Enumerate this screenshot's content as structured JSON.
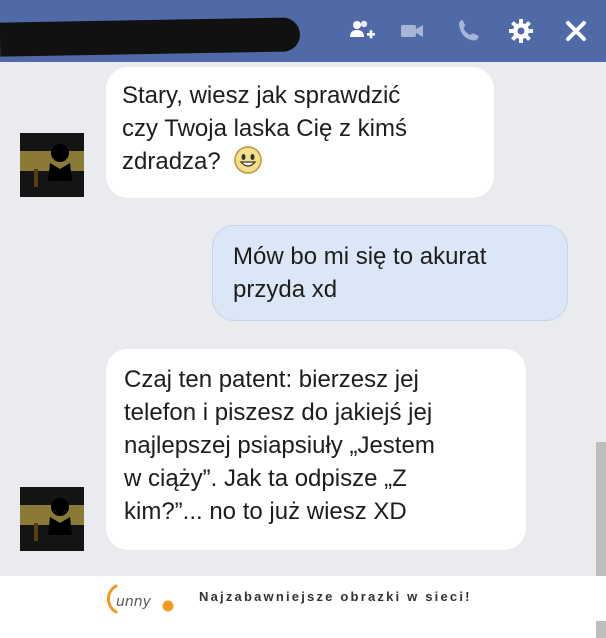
{
  "header": {
    "icons": [
      "add-people-icon",
      "video-call-icon",
      "phone-call-icon",
      "gear-icon",
      "close-icon"
    ],
    "colors": {
      "bar": "#4f6aa6",
      "icon": "#ffffff"
    }
  },
  "messages": [
    {
      "side": "incoming",
      "text": "Stary, wiesz jak sprawdzić\nczy Twoja laska Cię z kimś\nzdradza?",
      "emoji": "smiley-icon"
    },
    {
      "side": "outgoing",
      "text": "Mów bo mi się to akurat\nprzyda xd"
    },
    {
      "side": "incoming",
      "text": "Czaj ten patent: bierzesz jej\ntelefon i piszesz do jakiejś jej\nnajlepszej psiapsiuły „Jestem\nw ciąży”. Jak ta odpisze „Z\nkim?”... no to już wiesz XD"
    }
  ],
  "footer": {
    "logo_text": "funny",
    "tagline": "Najzabawniejsze obrazki w sieci!"
  }
}
